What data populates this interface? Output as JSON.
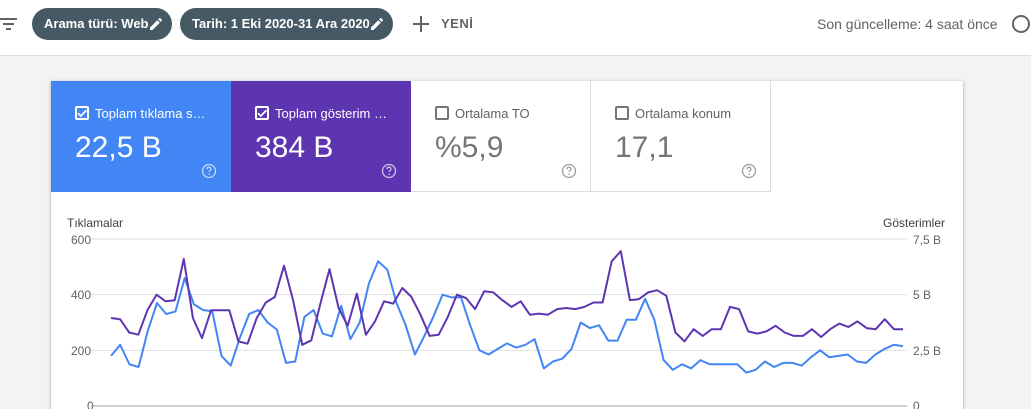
{
  "toolbar": {
    "filter_icon": "filter-list-icon",
    "chip_search_type": "Arama türü: Web",
    "chip_date": "Tarih: 1 Eki 2020-31 Ara 2020",
    "new_label": "YENİ",
    "last_update": "Son güncelleme: 4 saat önce"
  },
  "metrics": [
    {
      "label": "Toplam tıklama s…",
      "value": "22,5 B",
      "checked": true,
      "color": "#4285f4"
    },
    {
      "label": "Toplam gösterim …",
      "value": "384 B",
      "checked": true,
      "color": "#5e35b1"
    },
    {
      "label": "Ortalama TO",
      "value": "%5,9",
      "checked": false,
      "color": "#ffffff"
    },
    {
      "label": "Ortalama konum",
      "value": "17,1",
      "checked": false,
      "color": "#ffffff"
    }
  ],
  "chart_data": {
    "type": "line",
    "left_axis_title": "Tıklamalar",
    "right_axis_title": "Gösterimler",
    "left_ticks": [
      "600",
      "400",
      "200",
      "0"
    ],
    "right_ticks": [
      "7,5 B",
      "5 B",
      "2,5 B",
      "0"
    ],
    "ylim_left": [
      0,
      600
    ],
    "ylim_right": [
      0,
      7.5
    ],
    "series": [
      {
        "name": "Tıklamalar",
        "color": "#4285f4",
        "axis": "left",
        "values": [
          180,
          220,
          150,
          140,
          270,
          370,
          330,
          340,
          460,
          365,
          345,
          340,
          180,
          145,
          245,
          330,
          345,
          300,
          275,
          155,
          160,
          320,
          345,
          260,
          250,
          360,
          240,
          300,
          440,
          520,
          490,
          370,
          290,
          185,
          250,
          320,
          400,
          390,
          390,
          290,
          200,
          185,
          205,
          225,
          210,
          220,
          240,
          135,
          160,
          170,
          205,
          300,
          280,
          290,
          235,
          235,
          310,
          310,
          385,
          310,
          165,
          130,
          150,
          135,
          165,
          150,
          150,
          150,
          150,
          120,
          130,
          160,
          140,
          155,
          155,
          145,
          175,
          200,
          175,
          180,
          185,
          160,
          155,
          185,
          205,
          220,
          215
        ]
      },
      {
        "name": "Gösterimler",
        "color": "#5e35b1",
        "axis": "right",
        "values": [
          3.95,
          3.9,
          3.3,
          3.2,
          4.3,
          5.0,
          4.7,
          4.75,
          6.6,
          3.95,
          3.05,
          4.3,
          4.3,
          4.3,
          2.9,
          2.8,
          3.95,
          4.65,
          4.9,
          6.3,
          4.75,
          2.75,
          2.95,
          4.6,
          6.15,
          4.4,
          3.6,
          5.05,
          3.2,
          3.8,
          4.7,
          4.6,
          5.3,
          4.9,
          4.1,
          3.15,
          3.2,
          4.0,
          5.0,
          4.85,
          4.35,
          5.15,
          5.1,
          4.75,
          4.45,
          4.7,
          4.1,
          4.15,
          4.1,
          4.35,
          4.4,
          4.35,
          4.45,
          4.65,
          4.65,
          6.5,
          6.95,
          4.75,
          4.8,
          5.1,
          5.2,
          4.95,
          3.3,
          2.9,
          3.45,
          3.15,
          3.45,
          3.45,
          4.45,
          4.35,
          3.35,
          3.25,
          3.35,
          3.6,
          3.3,
          3.15,
          3.15,
          3.45,
          3.1,
          3.45,
          3.7,
          3.55,
          3.8,
          3.5,
          3.45,
          3.9,
          3.45,
          3.45
        ]
      }
    ]
  }
}
